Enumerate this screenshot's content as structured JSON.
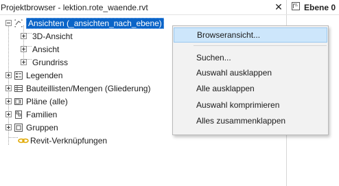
{
  "panel": {
    "title": "Projektbrowser - lektion.rote_waende.rvt",
    "close_glyph": "✕"
  },
  "tab": {
    "label": "Ebene 0"
  },
  "tree": {
    "root": "Ansichten (_ansichten_nach_ebene)",
    "children": [
      "3D-Ansicht",
      "Ansicht",
      "Grundriss"
    ],
    "items": [
      "Legenden",
      "Bauteillisten/Mengen (Gliederung)",
      "Pläne (alle)",
      "Familien",
      "Gruppen",
      "Revit-Verknüpfungen"
    ]
  },
  "context_menu": {
    "items": [
      "Browseransicht...",
      "Suchen...",
      "Auswahl ausklappen",
      "Alle ausklappen",
      "Auswahl komprimieren",
      "Alles zusammenklappen"
    ],
    "highlighted": "Browseransicht..."
  },
  "colors": {
    "selection": "#0a64c8",
    "menu_hover": "#cde6fb",
    "link_icon": "#e0a800"
  },
  "icons": {
    "root": "views-icon",
    "legend": "legend-icon",
    "schedule": "schedule-icon",
    "sheets": "sheets-icon",
    "families": "families-icon",
    "groups": "groups-icon",
    "revit_links": "link-icon",
    "tab": "view-tab-icon"
  }
}
